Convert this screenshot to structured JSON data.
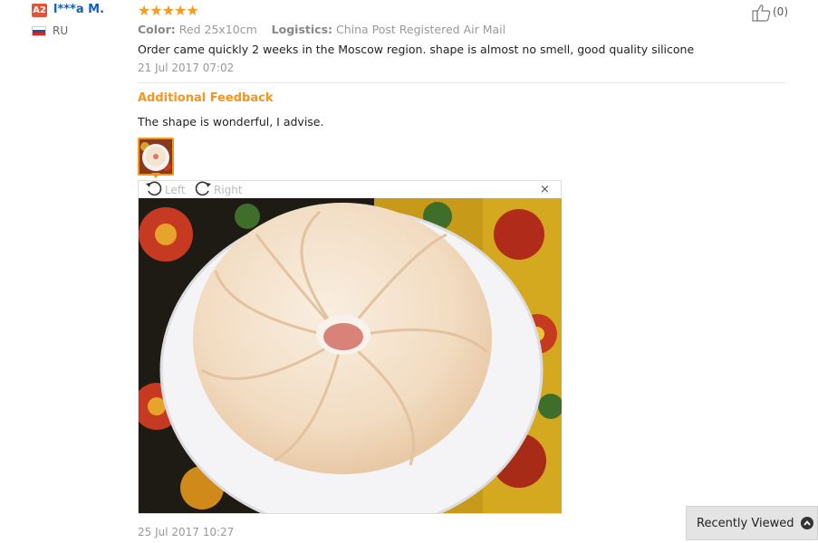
{
  "reviewer": {
    "badge": "A2",
    "name": "l***a M.",
    "country": "RU"
  },
  "rating": {
    "stars": 5,
    "max": 5,
    "display": "★★★★★"
  },
  "order_info": {
    "color_label": "Color:",
    "color_value": "Red 25x10cm",
    "logistics_label": "Logistics:",
    "logistics_value": "China Post Registered Air Mail"
  },
  "review": {
    "text": "Order came quickly 2 weeks in the Moscow region. shape is almost no smell, good quality silicone",
    "date": "21 Jul 2017 07:02"
  },
  "helpful": {
    "count_text": "(0)"
  },
  "additional_feedback": {
    "title": "Additional Feedback",
    "text": "The shape is wonderful, I advise.",
    "date": "25 Jul 2017 10:27"
  },
  "image_viewer": {
    "rotate_left_label": "Left",
    "rotate_right_label": "Right",
    "close_glyph": "×"
  },
  "recently_viewed": {
    "label": "Recently Viewed"
  },
  "colors": {
    "accent_orange": "#f7941d",
    "star": "#f79a1d",
    "link_blue": "#1260b5",
    "badge_red": "#e0543b"
  }
}
